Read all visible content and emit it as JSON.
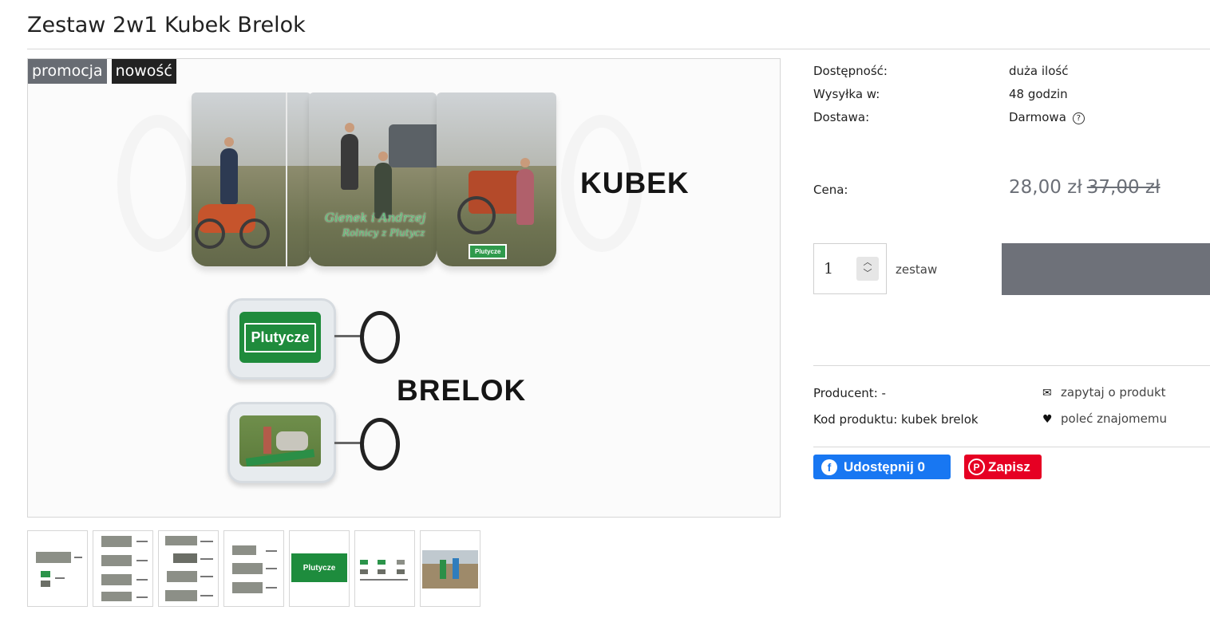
{
  "product": {
    "title": "Zestaw 2w1 Kubek Brelok",
    "badges": {
      "promo": "promocja",
      "new": "nowość"
    },
    "image_words": {
      "mug": "KUBEK",
      "keychain": "BRELOK"
    },
    "image_sign_text": "Plutycze",
    "mug_caption_line1": "Gienek i Andrzej",
    "mug_caption_line2": "Rolnicy z Plutycz"
  },
  "thumbnails": [
    {
      "name": "thumb-1"
    },
    {
      "name": "thumb-2"
    },
    {
      "name": "thumb-3"
    },
    {
      "name": "thumb-4"
    },
    {
      "name": "thumb-5",
      "text": "Plutycze"
    },
    {
      "name": "thumb-6"
    },
    {
      "name": "thumb-7"
    }
  ],
  "info": {
    "availability_label": "Dostępność:",
    "availability_value": "duża ilość",
    "shipping_label": "Wysyłka w:",
    "shipping_value": "48 godzin",
    "delivery_label": "Dostawa:",
    "delivery_value": "Darmowa",
    "price_label": "Cena:",
    "price_current": "28,00 zł",
    "price_old": "37,00 zł",
    "quantity": "1",
    "unit": "zestaw",
    "producer_label": "Producent:",
    "producer_value": "-",
    "code_label": "Kod produktu:",
    "code_value": "kubek brelok",
    "ask_link": "zapytaj o produkt",
    "recommend_link": "poleć znajomemu",
    "fb_share": "Udostępnij 0",
    "pin_save": "Zapisz"
  },
  "colors": {
    "badge_promo": "#686c73",
    "badge_new": "#222222",
    "price": "#6b6f77",
    "cart_button": "#6e7179",
    "facebook": "#1877f2",
    "pinterest": "#e60023"
  }
}
